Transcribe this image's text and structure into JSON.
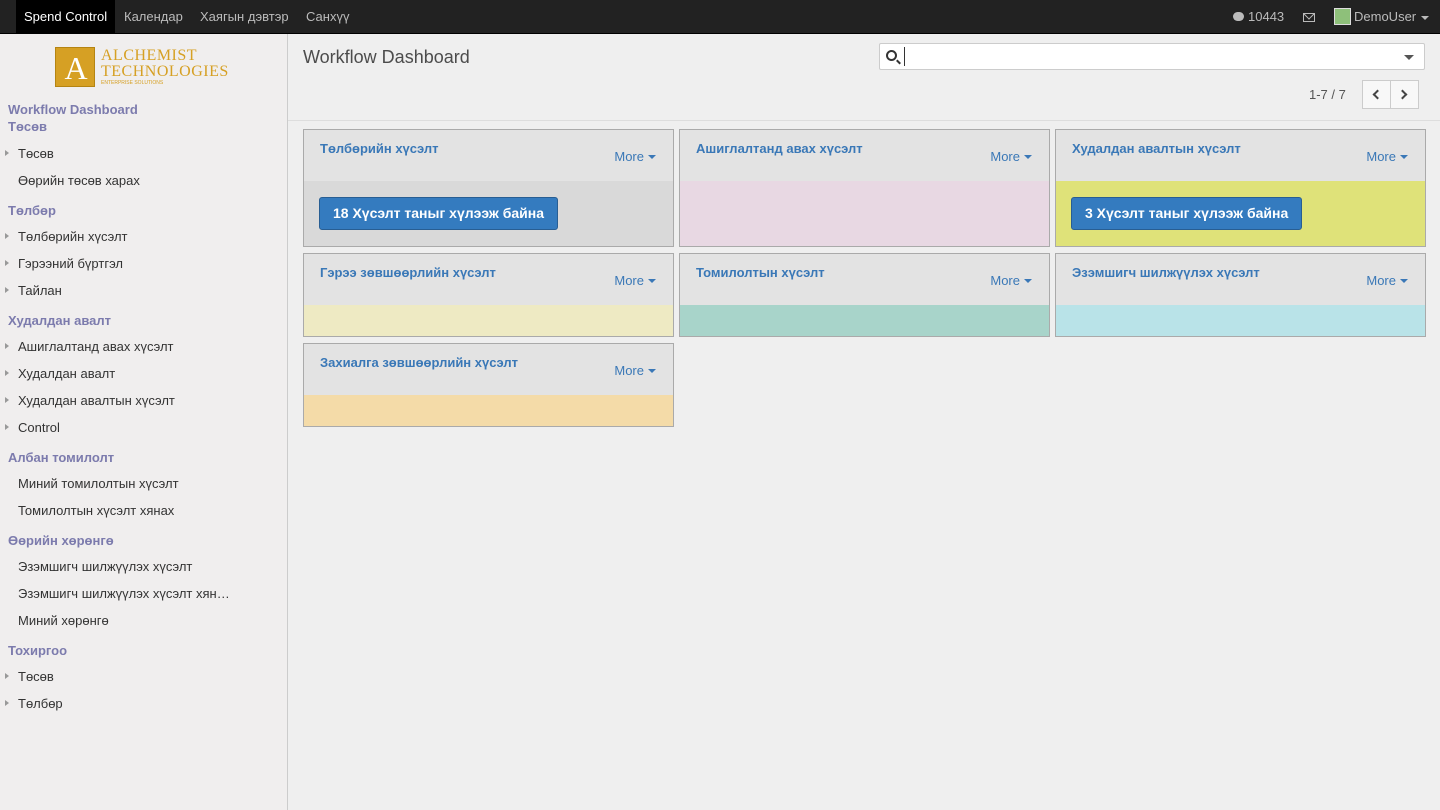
{
  "topbar": {
    "menu": [
      "Spend Control",
      "Календар",
      "Хаягын дэвтэр",
      "Санхүү"
    ],
    "chat_count": "10443",
    "user": "DemoUser"
  },
  "logo": {
    "mark": "A",
    "line1": "ALCHEMIST",
    "line2": "TECHNOLOGIES",
    "line3": "ENTERPRISE SOLUTIONS"
  },
  "sidebar": {
    "workflow_dashboard": "Workflow Dashboard",
    "sections": [
      {
        "header": "Төсөв",
        "items": [
          {
            "label": "Төсөв",
            "arrow": true
          },
          {
            "label": "Өөрийн төсөв харах",
            "arrow": false
          }
        ]
      },
      {
        "header": "Төлбөр",
        "items": [
          {
            "label": "Төлбөрийн хүсэлт",
            "arrow": true
          },
          {
            "label": "Гэрээний бүртгэл",
            "arrow": true
          },
          {
            "label": "Тайлан",
            "arrow": true
          }
        ]
      },
      {
        "header": "Худалдан авалт",
        "items": [
          {
            "label": "Ашиглалтанд авах хүсэлт",
            "arrow": true
          },
          {
            "label": "Худалдан авалт",
            "arrow": true
          },
          {
            "label": "Худалдан авалтын хүсэлт",
            "arrow": true
          },
          {
            "label": "Control",
            "arrow": true
          }
        ]
      },
      {
        "header": "Албан томилолт",
        "items": [
          {
            "label": "Миний томилолтын хүсэлт",
            "arrow": false
          },
          {
            "label": "Томилолтын хүсэлт хянах",
            "arrow": false
          }
        ]
      },
      {
        "header": "Өөрийн хөрөнгө",
        "items": [
          {
            "label": "Эзэмшигч шилжүүлэх хүсэлт",
            "arrow": false
          },
          {
            "label": "Эзэмшигч шилжүүлэх хүсэлт хян…",
            "arrow": false
          },
          {
            "label": "Миний хөрөнгө",
            "arrow": false
          }
        ]
      },
      {
        "header": "Тохиргоо",
        "items": [
          {
            "label": "Төсөв",
            "arrow": true
          },
          {
            "label": "Төлбөр",
            "arrow": true
          }
        ]
      }
    ]
  },
  "main": {
    "title": "Workflow Dashboard",
    "search_value": "",
    "pager": "1-7 / 7"
  },
  "cards": [
    {
      "title": "Төлбөрийн хүсэлт",
      "more": "More",
      "color": "#d9d9d9",
      "button": "18 Хүсэлт таныг хүлээж байна"
    },
    {
      "title": "Ашиглалтанд авах хүсэлт",
      "more": "More",
      "color": "#e8d8e3",
      "button": null
    },
    {
      "title": "Худалдан авалтын хүсэлт",
      "more": "More",
      "color": "#dfe279",
      "button": "3 Хүсэлт таныг хүлээж байна"
    },
    {
      "title": "Гэрээ зөвшөөрлийн хүсэлт",
      "more": "More",
      "color": "#eeeac3",
      "button": null
    },
    {
      "title": "Томилолтын хүсэлт",
      "more": "More",
      "color": "#a8d4ca",
      "button": null
    },
    {
      "title": "Эзэмшигч шилжүүлэх хүсэлт",
      "more": "More",
      "color": "#b9e3e8",
      "button": null
    },
    {
      "title": "Захиалга зөвшөөрлийн хүсэлт",
      "more": "More",
      "color": "#f4dba8",
      "button": null
    }
  ]
}
